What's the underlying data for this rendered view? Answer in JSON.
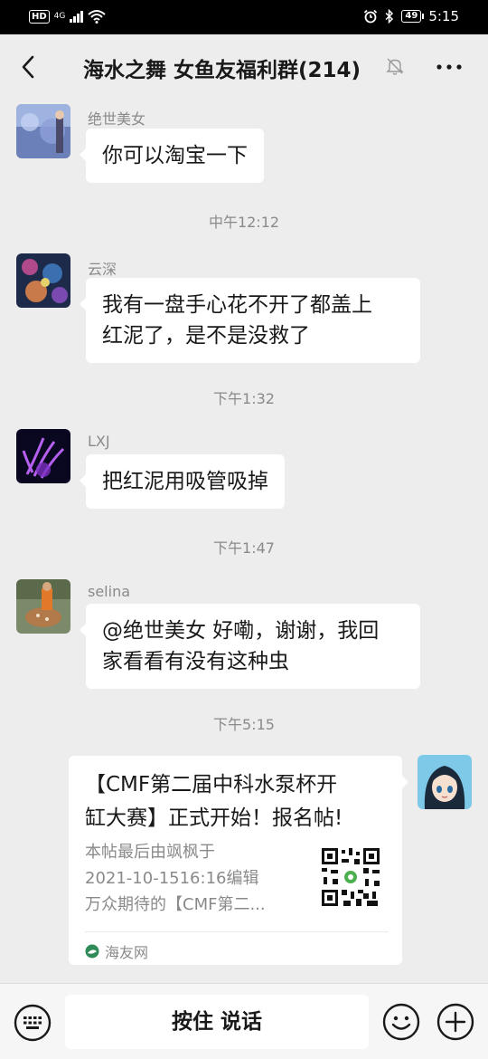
{
  "status_bar": {
    "hd": "HD",
    "network": "4G",
    "battery": "49",
    "time": "5:15"
  },
  "header": {
    "title": "海水之舞 女鱼友福利群(214)",
    "icons": [
      "back-icon",
      "mute-bell-icon",
      "more-icon"
    ]
  },
  "messages": [
    {
      "sender": "绝世美女",
      "text": "你可以淘宝一下"
    },
    {
      "timestamp": "中午12:12"
    },
    {
      "sender": "云深",
      "lines": [
        "我有一盘手心花不开了都盖上",
        "红泥了，是不是没救了"
      ]
    },
    {
      "timestamp": "下午1:32"
    },
    {
      "sender": "LXJ",
      "text": "把红泥用吸管吸掉"
    },
    {
      "timestamp": "下午1:47"
    },
    {
      "sender": "selina",
      "lines": [
        "@绝世美女  好嘞，谢谢，我回",
        "家看看有没有这种虫"
      ]
    },
    {
      "timestamp": "下午5:15"
    }
  ],
  "link_card": {
    "title_lines": [
      "【CMF第二届中科水泵杯开",
      "缸大赛】正式开始！报名帖!"
    ],
    "desc_lines": [
      "本帖最后由飒枫于",
      "2021-10-1516:16编辑",
      "万众期待的【CMF第二..."
    ],
    "source": "海友网"
  },
  "input_bar": {
    "talk_label": "按住 说话",
    "icons": [
      "keyboard-icon",
      "emoji-icon",
      "plus-icon"
    ]
  },
  "colors": {
    "background": "#ededed",
    "bubble": "#ffffff",
    "meta_text": "#8a8a8a",
    "source_icon": "#2e8b57"
  }
}
